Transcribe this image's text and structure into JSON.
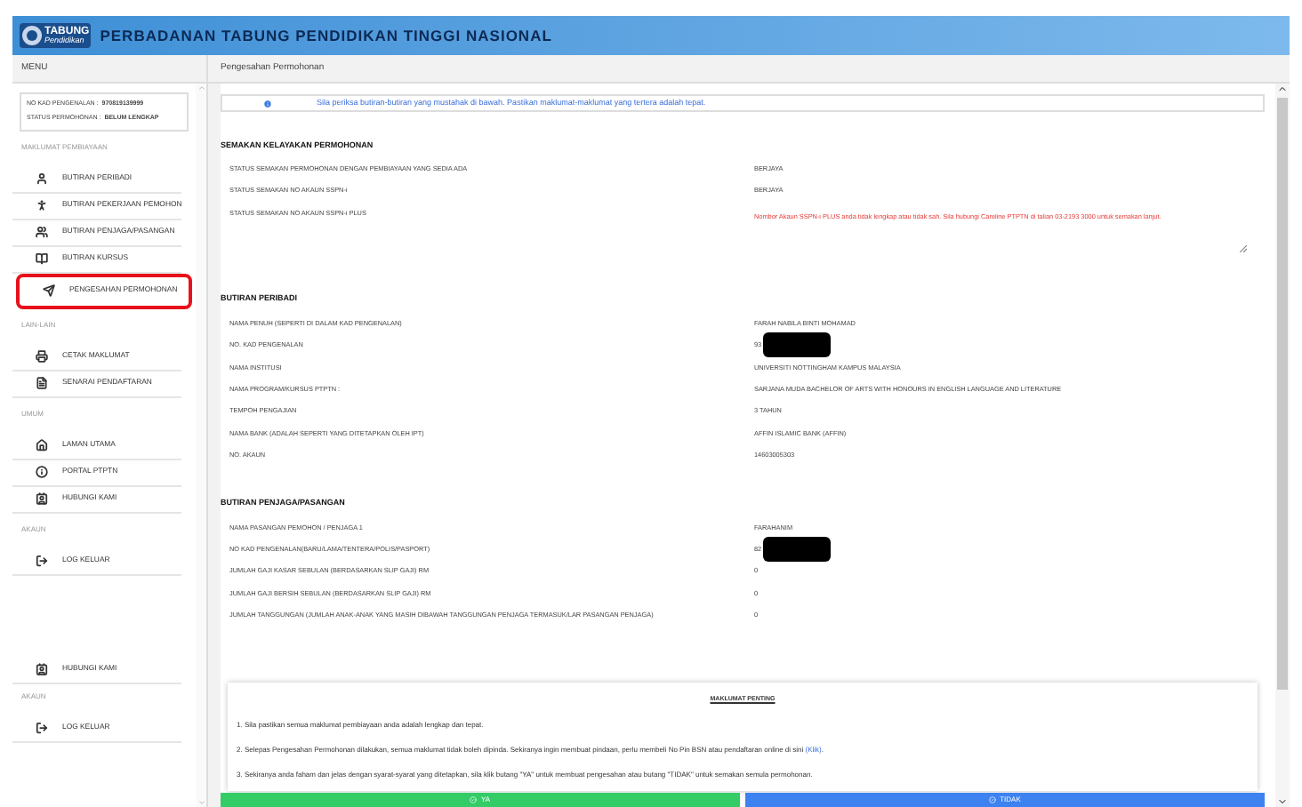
{
  "header": {
    "logo": {
      "word": "TABUNG",
      "sub": "Pendidikan"
    },
    "title": "PERBADANAN TABUNG PENDIDIKAN TINGGI NASIONAL"
  },
  "sidebar": {
    "title": "MENU",
    "profile": [
      {
        "label": "NO KAD PENGENALAN :",
        "value": "970819139999"
      },
      {
        "label": "STATUS PERMOHONAN :",
        "value": "BELUM LENGKAP"
      }
    ],
    "sections": [
      {
        "title": "MAKLUMAT PEMBIAYAAN",
        "items": [
          {
            "label": "BUTIRAN PERIBADI",
            "selected": false
          },
          {
            "label": "BUTIRAN PEKERJAAN PEMOHON",
            "selected": false
          },
          {
            "label": "BUTIRAN PENJAGA/PASANGAN",
            "selected": false
          },
          {
            "label": "BUTIRAN KURSUS",
            "selected": false
          },
          {
            "label": "PENGESAHAN PERMOHONAN",
            "selected": true
          }
        ]
      },
      {
        "title": "LAIN-LAIN",
        "items": [
          {
            "label": "CETAK MAKLUMAT",
            "selected": false
          },
          {
            "label": "SENARAI PENDAFTARAN",
            "selected": false
          }
        ]
      },
      {
        "title": "UMUM",
        "items": [
          {
            "label": "LAMAN UTAMA",
            "selected": false
          },
          {
            "label": "PORTAL PTPTN",
            "selected": false
          },
          {
            "label": "HUBUNGI KAMI",
            "selected": false
          }
        ]
      },
      {
        "title": "AKAUN",
        "items": [
          {
            "label": "LOG KELUAR",
            "selected": false
          }
        ]
      }
    ],
    "footer": [
      {
        "label": "HUBUNGI KAMI",
        "kind": "contact"
      },
      {
        "label": "AKAUN",
        "kind": "heading"
      },
      {
        "label": "LOG KELUAR",
        "kind": "logout"
      }
    ]
  },
  "main": {
    "title": "Pengesahan Permohonan",
    "alert": "Sila periksa butiran-butiran yang mustahak di bawah. Pastikan maklumat-maklumat yang tertera adalah tepat.",
    "sections": [
      {
        "title": "SEMAKAN KELAYAKAN PERMOHONAN",
        "rows": [
          {
            "label": "STATUS SEMAKAN PERMOHONAN DENGAN PEMBIAYAAN YANG SEDIA ADA",
            "value": "BERJAYA",
            "kind": "text",
            "redacted": false
          },
          {
            "label": "STATUS SEMAKAN NO AKAUN SSPN-i",
            "value": "BERJAYA",
            "kind": "text",
            "redacted": false
          },
          {
            "label": "STATUS SEMAKAN NO AKAUN SSPN-i PLUS",
            "value": "Nombor Akaun SSPN-i PLUS anda tidak lengkap atau tidak sah. Sila hubungi Careline PTPTN di talian 03-2193 3000 untuk semakan lanjut.",
            "kind": "error",
            "redacted": false
          }
        ]
      },
      {
        "title": "BUTIRAN PERIBADI",
        "rows": [
          {
            "label": "NAMA PENUH (SEPERTI DI DALAM KAD PENGENALAN)",
            "value": "FARAH NABILA BINTI MOHAMAD",
            "kind": "text",
            "redacted": false
          },
          {
            "label": "NO. KAD PENGENALAN",
            "value": "93",
            "kind": "text",
            "redacted": true
          },
          {
            "label": "NAMA INSTITUSI",
            "value": "UNIVERSITI NOTTINGHAM KAMPUS MALAYSIA",
            "kind": "text",
            "redacted": false
          },
          {
            "label": "NAMA PROGRAM/KURSUS PTPTN :",
            "value": "SARJANA MUDA BACHELOR OF ARTS WITH HONOURS IN ENGLISH LANGUAGE AND LITERATURE",
            "kind": "text",
            "redacted": false
          },
          {
            "label": "TEMPOH PENGAJIAN",
            "value": "3 TAHUN",
            "kind": "text",
            "redacted": false
          },
          {
            "label": "NAMA BANK (ADALAH SEPERTI YANG DITETAPKAN OLEH IPT)",
            "value": "AFFIN ISLAMIC BANK (AFFIN)",
            "kind": "text",
            "redacted": false
          },
          {
            "label": "NO. AKAUN",
            "value": "14603005303",
            "kind": "text",
            "redacted": false
          }
        ]
      },
      {
        "title": "BUTIRAN PENJAGA/PASANGAN",
        "rows": [
          {
            "label": "NAMA PASANGAN PEMOHON / PENJAGA 1",
            "value": "FARAHANIM",
            "kind": "text",
            "redacted": false
          },
          {
            "label": "NO KAD PENGENALAN(BARU/LAMA/TENTERA/POLIS/PASPORT)",
            "value": "82",
            "kind": "text",
            "redacted": true
          },
          {
            "label": "JUMLAH GAJI KASAR SEBULAN (BERDASARKAN SLIP GAJI) RM",
            "value": "0",
            "kind": "text",
            "redacted": false
          },
          {
            "label": "JUMLAH GAJI BERSIH SEBULAN (BERDASARKAN SLIP GAJI) RM",
            "value": "0",
            "kind": "text",
            "redacted": false
          },
          {
            "label": "JUMLAH TANGGUNGAN (JUMLAH ANAK-ANAK YANG MASIH DIBAWAH TANGGUNGAN PENJAGA TERMASUK/LAR PASANGAN PENJAGA)",
            "value": "0",
            "kind": "text",
            "redacted": false
          }
        ]
      }
    ],
    "notice": {
      "title": "MAKLUMAT PENTING",
      "items": [
        {
          "text": "1. Sila pastikan semua maklumat pembiayaan anda adalah lengkap dan tepat."
        },
        {
          "text": "2. Selepas Pengesahan Permohonan dilakukan, semua maklumat tidak boleh dipinda. Sekiranya ingin membuat pindaan, perlu membeli No Pin BSN atau pendaftaran online di sini",
          "link": "(Klik)",
          "after": "."
        },
        {
          "text": "3. Sekiranya anda faham dan jelas dengan syarat-syarat yang ditetapkan, sila klik butang \"YA\" untuk membuat pengesahan atau butang \"TIDAK\" untuk semakan semula permohonan."
        }
      ]
    },
    "buttons": [
      {
        "label": "YA",
        "kind": "confirm"
      },
      {
        "label": "TIDAK",
        "kind": "cancel"
      }
    ]
  }
}
